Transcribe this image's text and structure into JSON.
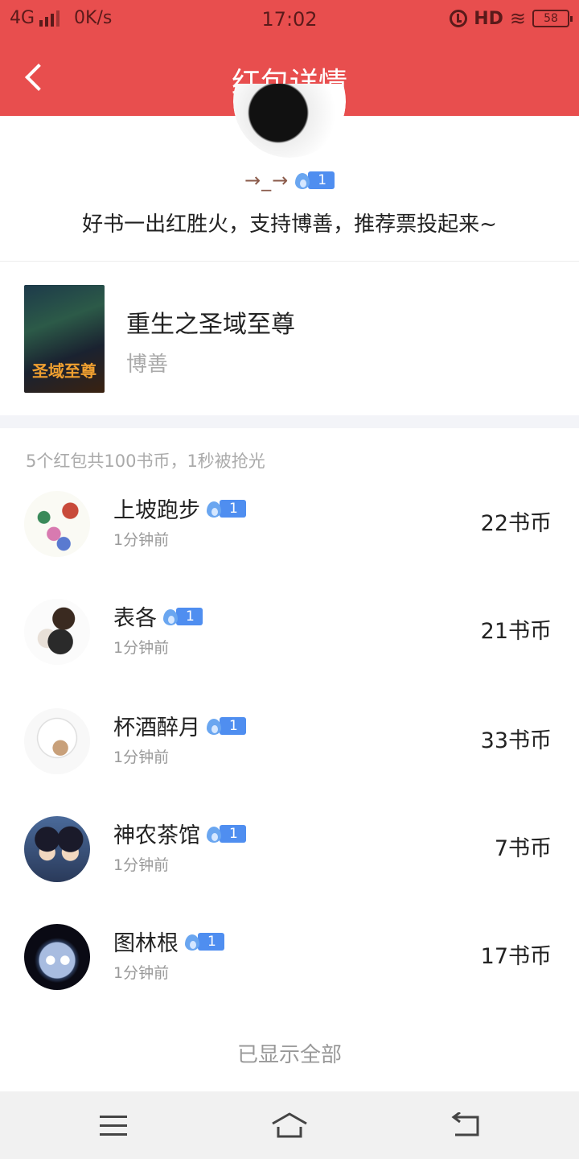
{
  "status_bar": {
    "network": "4G",
    "speed": "0K/s",
    "time": "17:02",
    "hd": "HD",
    "battery": "58"
  },
  "header": {
    "title": "红包详情"
  },
  "sender": {
    "name": "→_→",
    "level": "1",
    "message": "好书一出红胜火，支持博善，推荐票投起来~"
  },
  "book": {
    "title": "重生之圣域至尊",
    "author": "博善",
    "cover_text": "圣域至尊"
  },
  "summary": "5个红包共100书币，1秒被抢光",
  "recipients": [
    {
      "name": "上坡跑步",
      "level": "1",
      "time": "1分钟前",
      "amount": "22书币"
    },
    {
      "name": "表各",
      "level": "1",
      "time": "1分钟前",
      "amount": "21书币"
    },
    {
      "name": "杯酒醉月",
      "level": "1",
      "time": "1分钟前",
      "amount": "33书币"
    },
    {
      "name": "神农茶馆",
      "level": "1",
      "time": "1分钟前",
      "amount": "7书币"
    },
    {
      "name": "图林根",
      "level": "1",
      "time": "1分钟前",
      "amount": "17书币"
    }
  ],
  "footer": "已显示全部",
  "colors": {
    "brand_red": "#e84e4e",
    "badge_blue": "#4f8ef0",
    "muted_text": "#999999"
  }
}
